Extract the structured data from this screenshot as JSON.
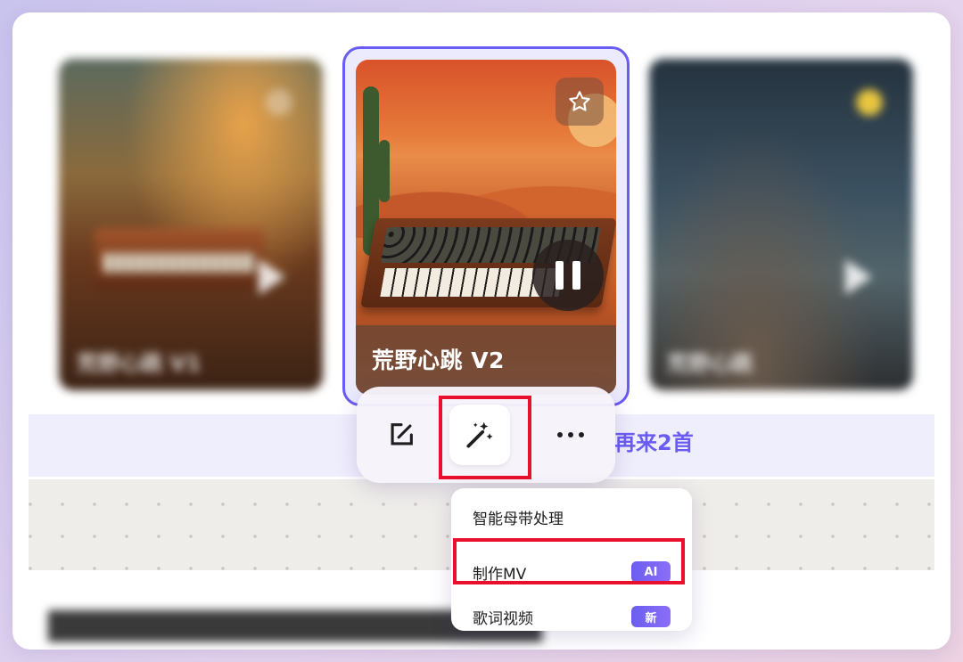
{
  "cards": {
    "left": {
      "title": "荒野心跳 V1",
      "state": "paused"
    },
    "center": {
      "title": "荒野心跳 V2",
      "state": "playing",
      "selected": true
    },
    "right": {
      "title": "荒野心跳",
      "state": "paused"
    }
  },
  "toolbar": {
    "edit_icon": "edit-icon",
    "magic_icon": "magic-wand-icon",
    "more_icon": "more-icon",
    "regenerate_label": "再来2首"
  },
  "menu": {
    "items": [
      {
        "label": "智能母带处理",
        "badge": ""
      },
      {
        "label": "制作MV",
        "badge": "AI"
      },
      {
        "label": "歌词视频",
        "badge": "新"
      }
    ]
  },
  "colors": {
    "accent": "#6a5cf2",
    "highlight": "#e8102c"
  }
}
